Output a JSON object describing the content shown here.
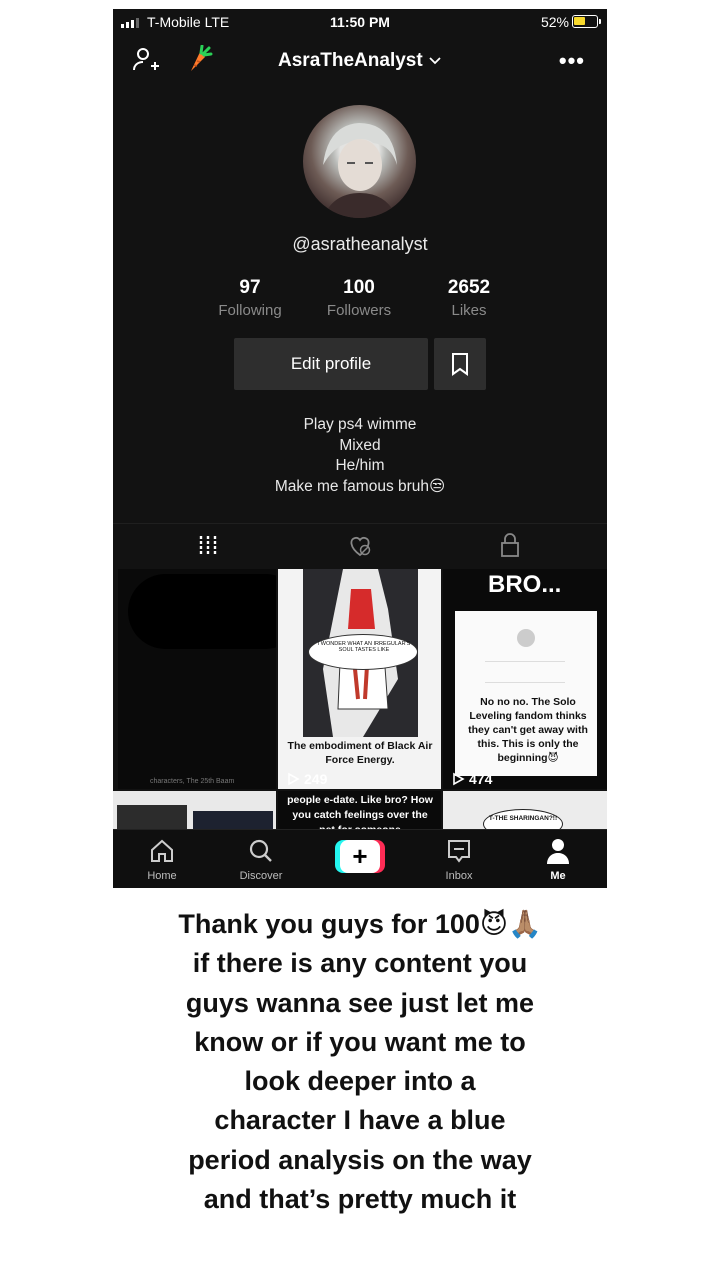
{
  "status_bar": {
    "carrier": "T-Mobile  LTE",
    "time": "11:50 PM",
    "battery": "52%",
    "battery_level": 0.52
  },
  "header": {
    "username": "AsraTheAnalyst"
  },
  "profile": {
    "handle": "@asratheanalyst",
    "stats": [
      {
        "value": "97",
        "label": "Following"
      },
      {
        "value": "100",
        "label": "Followers"
      },
      {
        "value": "2652",
        "label": "Likes"
      }
    ],
    "edit_button": "Edit profile",
    "bio": [
      "Play ps4 wimme",
      "Mixed",
      "He/him",
      "Make me famous bruh😒"
    ]
  },
  "videos": [
    {
      "caption": "",
      "views": "",
      "corner_text": "characters, The 25th Baam"
    },
    {
      "bubble": "I WONDER WHAT AN IRREGULAR'S SOUL TASTES LIKE",
      "caption": "The embodiment of Black Air Force Energy.",
      "views": "249"
    },
    {
      "header": "BRO...",
      "caption": "No no no. The Solo Leveling fandom thinks they can't get away with this. This is only the beginning😈",
      "views": "474"
    },
    {
      "caption": ""
    },
    {
      "caption": "people e-date. Like bro? How you catch feelings over the net for someone"
    },
    {
      "caption": "T-THE SHARINGAN?!!"
    }
  ],
  "bottom_nav": [
    {
      "label": "Home",
      "icon": "home-icon"
    },
    {
      "label": "Discover",
      "icon": "search-icon"
    },
    {
      "label": "",
      "icon": "create-plus-icon"
    },
    {
      "label": "Inbox",
      "icon": "inbox-icon"
    },
    {
      "label": "Me",
      "icon": "profile-icon"
    }
  ],
  "caption_lines": [
    "Thank you guys for 100😈🙏🏽",
    "if there is any content you",
    "guys wanna see just let me",
    "know or if you want me to",
    "look deeper into a",
    "character I have a blue",
    "period analysis on the way",
    "and that’s pretty much it"
  ],
  "colors": {
    "tiktok_cyan": "#24f6f0",
    "tiktok_red": "#fe2c55",
    "battery_yellow": "#f8d92d"
  }
}
